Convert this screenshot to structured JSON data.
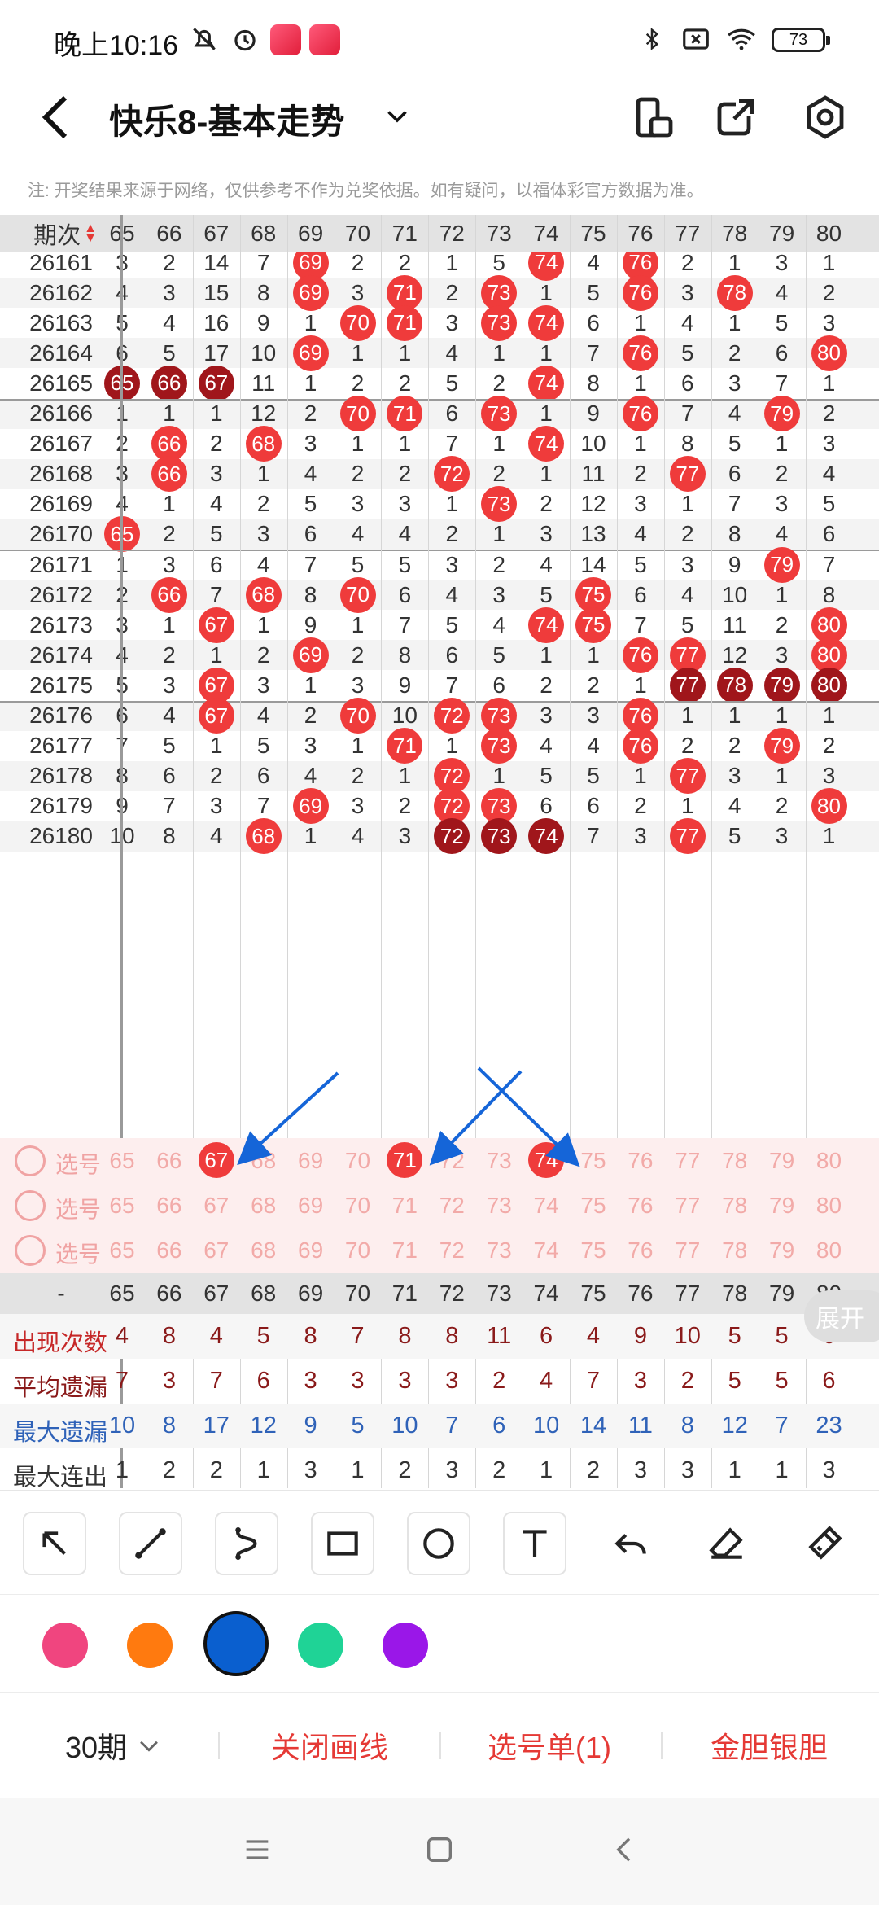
{
  "status_bar": {
    "time": "晚上10:16",
    "battery": "73"
  },
  "header": {
    "title": "快乐8-基本走势"
  },
  "notice": "注: 开奖结果来源于网络，仅供参考不作为兑奖依据。如有疑问，以福体彩官方数据为准。",
  "table": {
    "period_header": "期次",
    "columns": [
      "65",
      "66",
      "67",
      "68",
      "69",
      "70",
      "71",
      "72",
      "73",
      "74",
      "75",
      "76",
      "77",
      "78",
      "79",
      "80"
    ],
    "rows": [
      {
        "period": "26161",
        "cells": [
          "3",
          "2",
          "14",
          "7",
          "69",
          "2",
          "2",
          "1",
          "5",
          "74",
          "4",
          "76",
          "2",
          "1",
          "3",
          "1"
        ]
      },
      {
        "period": "26162",
        "cells": [
          "4",
          "3",
          "15",
          "8",
          "69",
          "3",
          "71",
          "2",
          "73",
          "1",
          "5",
          "76",
          "3",
          "78",
          "4",
          "2"
        ]
      },
      {
        "period": "26163",
        "cells": [
          "5",
          "4",
          "16",
          "9",
          "1",
          "70",
          "71",
          "3",
          "73",
          "74",
          "6",
          "1",
          "4",
          "1",
          "5",
          "3"
        ]
      },
      {
        "period": "26164",
        "cells": [
          "6",
          "5",
          "17",
          "10",
          "69",
          "1",
          "1",
          "4",
          "1",
          "1",
          "7",
          "76",
          "5",
          "2",
          "6",
          "80"
        ]
      },
      {
        "period": "26165",
        "cells": [
          "65",
          "66",
          "67",
          "11",
          "1",
          "2",
          "2",
          "5",
          "2",
          "74",
          "8",
          "1",
          "6",
          "3",
          "7",
          "1"
        ]
      },
      {
        "period": "26166",
        "cells": [
          "1",
          "1",
          "1",
          "12",
          "2",
          "70",
          "71",
          "6",
          "73",
          "1",
          "9",
          "76",
          "7",
          "4",
          "79",
          "2"
        ]
      },
      {
        "period": "26167",
        "cells": [
          "2",
          "66",
          "2",
          "68",
          "3",
          "1",
          "1",
          "7",
          "1",
          "74",
          "10",
          "1",
          "8",
          "5",
          "1",
          "3"
        ]
      },
      {
        "period": "26168",
        "cells": [
          "3",
          "66",
          "3",
          "1",
          "4",
          "2",
          "2",
          "72",
          "2",
          "1",
          "11",
          "2",
          "77",
          "6",
          "2",
          "4"
        ]
      },
      {
        "period": "26169",
        "cells": [
          "4",
          "1",
          "4",
          "2",
          "5",
          "3",
          "3",
          "1",
          "73",
          "2",
          "12",
          "3",
          "1",
          "7",
          "3",
          "5"
        ]
      },
      {
        "period": "26170",
        "cells": [
          "65",
          "2",
          "5",
          "3",
          "6",
          "4",
          "4",
          "2",
          "1",
          "3",
          "13",
          "4",
          "2",
          "8",
          "4",
          "6"
        ]
      },
      {
        "period": "26171",
        "cells": [
          "1",
          "3",
          "6",
          "4",
          "7",
          "5",
          "5",
          "3",
          "2",
          "4",
          "14",
          "5",
          "3",
          "9",
          "79",
          "7"
        ]
      },
      {
        "period": "26172",
        "cells": [
          "2",
          "66",
          "7",
          "68",
          "8",
          "70",
          "6",
          "4",
          "3",
          "5",
          "75",
          "6",
          "4",
          "10",
          "1",
          "8"
        ]
      },
      {
        "period": "26173",
        "cells": [
          "3",
          "1",
          "67",
          "1",
          "9",
          "1",
          "7",
          "5",
          "4",
          "74",
          "75",
          "7",
          "5",
          "11",
          "2",
          "80"
        ]
      },
      {
        "period": "26174",
        "cells": [
          "4",
          "2",
          "1",
          "2",
          "69",
          "2",
          "8",
          "6",
          "5",
          "1",
          "1",
          "76",
          "77",
          "12",
          "3",
          "80"
        ]
      },
      {
        "period": "26175",
        "cells": [
          "5",
          "3",
          "67",
          "3",
          "1",
          "3",
          "9",
          "7",
          "6",
          "2",
          "2",
          "1",
          "77",
          "78",
          "79",
          "80"
        ]
      },
      {
        "period": "26176",
        "cells": [
          "6",
          "4",
          "67",
          "4",
          "2",
          "70",
          "10",
          "72",
          "73",
          "3",
          "3",
          "76",
          "1",
          "1",
          "1",
          "1"
        ]
      },
      {
        "period": "26177",
        "cells": [
          "7",
          "5",
          "1",
          "5",
          "3",
          "1",
          "71",
          "1",
          "73",
          "4",
          "4",
          "76",
          "2",
          "2",
          "79",
          "2"
        ]
      },
      {
        "period": "26178",
        "cells": [
          "8",
          "6",
          "2",
          "6",
          "4",
          "2",
          "1",
          "72",
          "1",
          "5",
          "5",
          "1",
          "77",
          "3",
          "1",
          "3"
        ]
      },
      {
        "period": "26179",
        "cells": [
          "9",
          "7",
          "3",
          "7",
          "69",
          "3",
          "2",
          "72",
          "73",
          "6",
          "6",
          "2",
          "1",
          "4",
          "2",
          "80"
        ]
      },
      {
        "period": "26180",
        "cells": [
          "10",
          "8",
          "4",
          "68",
          "1",
          "4",
          "3",
          "72",
          "73",
          "74",
          "7",
          "3",
          "77",
          "5",
          "3",
          "1"
        ]
      }
    ],
    "pick_label": "选号",
    "stats_dash": "-",
    "stats": [
      {
        "label": "出现次数",
        "values": [
          "4",
          "8",
          "4",
          "5",
          "8",
          "7",
          "8",
          "8",
          "11",
          "6",
          "4",
          "9",
          "10",
          "5",
          "5",
          "6"
        ]
      },
      {
        "label": "平均遗漏",
        "values": [
          "7",
          "3",
          "7",
          "6",
          "3",
          "3",
          "3",
          "3",
          "2",
          "4",
          "7",
          "3",
          "2",
          "5",
          "5",
          "6"
        ]
      },
      {
        "label": "最大遗漏",
        "values": [
          "10",
          "8",
          "17",
          "12",
          "9",
          "5",
          "10",
          "7",
          "6",
          "10",
          "14",
          "11",
          "8",
          "12",
          "7",
          "23"
        ]
      },
      {
        "label": "最大连出",
        "values": [
          "1",
          "2",
          "2",
          "1",
          "3",
          "1",
          "2",
          "3",
          "2",
          "1",
          "2",
          "3",
          "3",
          "1",
          "1",
          "3"
        ]
      }
    ],
    "expand_label": "展开"
  },
  "colors": {
    "accent": "#ef3b3b",
    "dark_ball": "#a0161b",
    "stat_brown": "#8a1a1a",
    "stat_blue": "#2f62b8",
    "arrow": "#1565d8"
  },
  "swatches": [
    "#f0457f",
    "#ff7a0f",
    "#0a5fcf",
    "#1fd396",
    "#9a17e8"
  ],
  "bottom": {
    "periods": "30期",
    "close_lines": "关闭画线",
    "pick_list": "选号单(1)",
    "gold": "金胆银胆"
  }
}
